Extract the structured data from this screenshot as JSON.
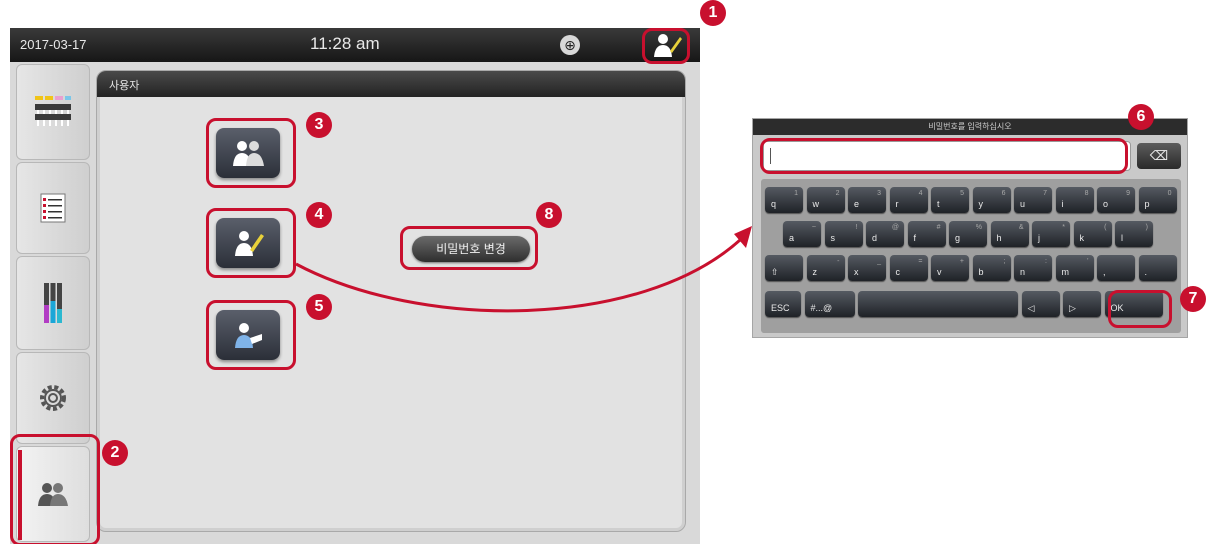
{
  "status_bar": {
    "date": "2017-03-17",
    "time": "11:28 am",
    "globe_icon": "globe-icon",
    "user_icon": "supervisor-user-icon"
  },
  "panel": {
    "title": "사용자"
  },
  "buttons": {
    "change_password": "비밀번호 변경"
  },
  "keyboard": {
    "title": "비밀번호를 입력하십시오",
    "input_value": "",
    "backspace_icon": "backspace-icon",
    "rows": [
      [
        {
          "k": "q",
          "s": "1"
        },
        {
          "k": "w",
          "s": "2"
        },
        {
          "k": "e",
          "s": "3"
        },
        {
          "k": "r",
          "s": "4"
        },
        {
          "k": "t",
          "s": "5"
        },
        {
          "k": "y",
          "s": "6"
        },
        {
          "k": "u",
          "s": "7"
        },
        {
          "k": "i",
          "s": "8"
        },
        {
          "k": "o",
          "s": "9"
        },
        {
          "k": "p",
          "s": "0"
        }
      ],
      [
        {
          "k": "a",
          "s": "~"
        },
        {
          "k": "s",
          "s": "!"
        },
        {
          "k": "d",
          "s": "@"
        },
        {
          "k": "f",
          "s": "#"
        },
        {
          "k": "g",
          "s": "%"
        },
        {
          "k": "h",
          "s": "&"
        },
        {
          "k": "j",
          "s": "*"
        },
        {
          "k": "k",
          "s": "("
        },
        {
          "k": "l",
          "s": ")"
        }
      ],
      [
        {
          "k": "⇧",
          "s": ""
        },
        {
          "k": "z",
          "s": "-"
        },
        {
          "k": "x",
          "s": "_"
        },
        {
          "k": "c",
          "s": "="
        },
        {
          "k": "v",
          "s": "+"
        },
        {
          "k": "b",
          "s": ";"
        },
        {
          "k": "n",
          "s": ":"
        },
        {
          "k": "m",
          "s": "'"
        },
        {
          "k": ",",
          "s": ""
        },
        {
          "k": ".",
          "s": ""
        }
      ],
      [
        {
          "k": "ESC",
          "s": ""
        },
        {
          "k": "#...@",
          "s": ""
        },
        {
          "k": "",
          "s": ""
        },
        {
          "k": "◁",
          "s": ""
        },
        {
          "k": "▷",
          "s": ""
        },
        {
          "k": "OK",
          "s": ""
        }
      ]
    ]
  },
  "callouts": [
    "1",
    "2",
    "3",
    "4",
    "5",
    "6",
    "7",
    "8"
  ],
  "colors": {
    "accent": "#c8102e",
    "header": "#232323",
    "panel": "#e2e2e2"
  }
}
